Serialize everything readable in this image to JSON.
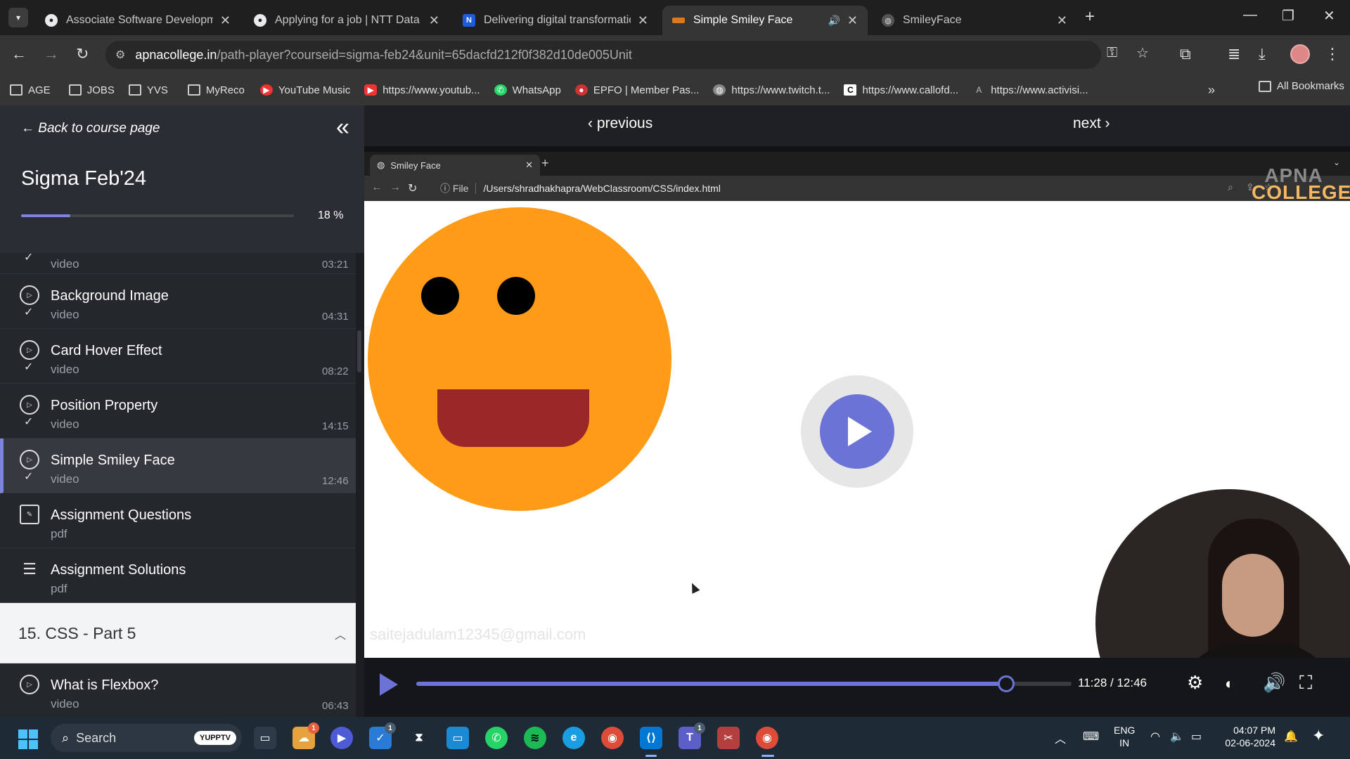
{
  "browser": {
    "tabs": [
      {
        "title": "Associate Software Developme",
        "icon": "github-icon"
      },
      {
        "title": "Applying for a job | NTT Data C",
        "icon": "github-icon"
      },
      {
        "title": "Delivering digital transformation",
        "icon": "ntt-icon"
      },
      {
        "title": "Simple Smiley Face",
        "icon": "apna-icon",
        "active": true,
        "audio": true
      },
      {
        "title": "SmileyFace",
        "icon": "globe-icon"
      }
    ],
    "url_host": "apnacollege.in",
    "url_rest": "/path-player?courseid=sigma-feb24&unit=65dacfd212f0f382d10de005Unit",
    "bookmarks": [
      {
        "label": "AGE",
        "icon": "folder-icon"
      },
      {
        "label": "JOBS",
        "icon": "folder-icon"
      },
      {
        "label": "YVS",
        "icon": "folder-icon"
      },
      {
        "label": "MyReco",
        "icon": "folder-icon"
      },
      {
        "label": "YouTube Music",
        "icon": "youtube-music-icon"
      },
      {
        "label": "https://www.youtub...",
        "icon": "youtube-icon"
      },
      {
        "label": "WhatsApp",
        "icon": "whatsapp-icon"
      },
      {
        "label": "EPFO | Member Pas...",
        "icon": "epfo-icon"
      },
      {
        "label": "https://www.twitch.t...",
        "icon": "globe-icon"
      },
      {
        "label": "https://www.callofd...",
        "icon": "callofduty-icon"
      },
      {
        "label": "https://www.activisi...",
        "icon": "activision-icon"
      }
    ],
    "all_bookmarks": "All Bookmarks"
  },
  "sidebar": {
    "back_label": "Back to course page",
    "course_title": "Sigma Feb'24",
    "progress_percent": 18,
    "progress_label": "18 %",
    "lessons": [
      {
        "title": "",
        "subtitle": "video",
        "duration": "03:21",
        "icon": "play-circle-icon",
        "done": true
      },
      {
        "title": "Background Image",
        "subtitle": "video",
        "duration": "04:31",
        "icon": "play-circle-icon",
        "done": true
      },
      {
        "title": "Card Hover Effect",
        "subtitle": "video",
        "duration": "08:22",
        "icon": "play-circle-icon",
        "done": true
      },
      {
        "title": "Position Property",
        "subtitle": "video",
        "duration": "14:15",
        "icon": "play-circle-icon",
        "done": true
      },
      {
        "title": "Simple Smiley Face",
        "subtitle": "video",
        "duration": "12:46",
        "icon": "play-circle-icon",
        "done": true,
        "active": true
      },
      {
        "title": "Assignment Questions",
        "subtitle": "pdf",
        "duration": "",
        "icon": "edit-icon",
        "done": false
      },
      {
        "title": "Assignment Solutions",
        "subtitle": "pdf",
        "duration": "",
        "icon": "checklist-icon",
        "done": false
      }
    ],
    "section": {
      "title": "15. CSS - Part 5"
    },
    "next_lesson": {
      "title": "What is Flexbox?",
      "subtitle": "video",
      "duration": "06:43"
    }
  },
  "player_nav": {
    "previous": "previous",
    "next": "next"
  },
  "video": {
    "inner_tab_title": "Smiley Face",
    "inner_file_label": "File",
    "inner_path": "/Users/shradhakhapra/WebClassroom/CSS/index.html",
    "logo_line1": "APNA",
    "logo_line2": "COLLEGE",
    "watermark": "saitejadulam12345@gmail.com",
    "colors": {
      "face": "#ff9b17",
      "mouth": "#9a2828",
      "accent": "#6b73d6"
    }
  },
  "controls": {
    "timecode": "11:28 / 12:46",
    "progress_fraction": 0.9
  },
  "taskbar": {
    "search_label": "Search",
    "search_badge": "YUPPTV",
    "apps": [
      "file-explorer-icon",
      "weather-icon",
      "zoom-icon",
      "todo-icon",
      "hourglass-icon",
      "remote-desktop-icon",
      "whatsapp-icon",
      "spotify-icon",
      "edge-icon",
      "chrome-icon",
      "vscode-icon",
      "teams-icon",
      "snipping-tool-icon",
      "chrome-profile-icon"
    ],
    "lang_line1": "ENG",
    "lang_line2": "IN",
    "time": "04:07 PM",
    "date": "02-06-2024"
  }
}
